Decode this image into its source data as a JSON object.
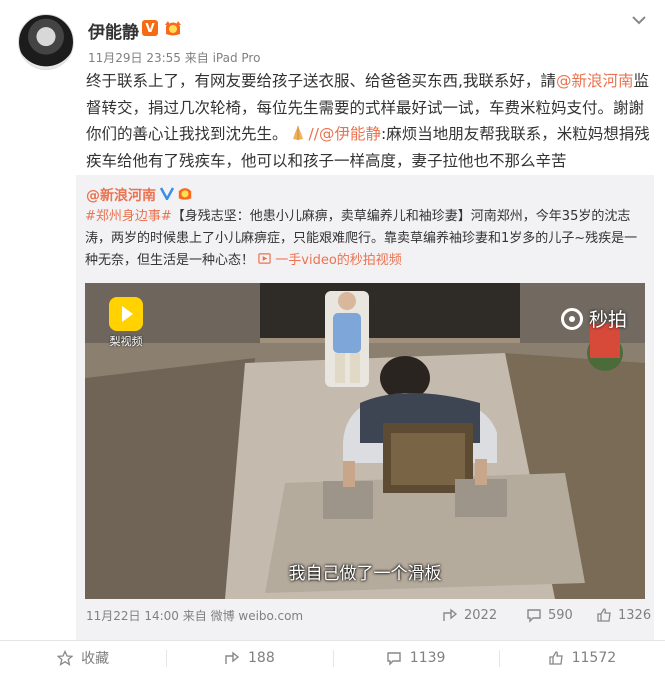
{
  "post": {
    "username": "伊能静",
    "verified_badge": "V",
    "timestamp": "11月29日 23:55",
    "source": "来自 iPad Pro",
    "text_parts": {
      "p1": "终于联系上了，有网友要给孩子送衣服、给爸爸买东西,我联系好，請",
      "mention1": "@新浪河南",
      "p2": "监督转交，捐过几次轮椅，每位先生需要的式样最好试一试，车费米粒妈支付。謝謝你们的善心让我找到沈先生。",
      "mention2": "//@伊能静",
      "p3": ":麻烦当地朋友帮我联系，米粒妈想捐残疾车给他有了残疾车，他可以和孩子一样高度，妻子拉他也不那么辛苦"
    }
  },
  "original": {
    "username": "@新浪河南",
    "text_parts": {
      "topic": "#郑州身边事#",
      "body": "【身残志坚：他患小儿麻痹，卖草编养儿和袖珍妻】河南郑州，今年35岁的沈志涛，两岁的时候患上了小儿麻痹症，只能艰难爬行。靠卖草编养袖珍妻和1岁多的儿子~残疾是一种无奈，但生活是一种心态！",
      "video_link": "一手video的秒拍视频"
    },
    "video": {
      "app_logo_label": "梨视频",
      "watermark": "秒拍",
      "subtitle": "我自己做了一个滑板"
    },
    "timestamp": "11月22日 14:00",
    "source": "来自 微博 weibo.com",
    "reposts": "2022",
    "comments": "590",
    "likes": "1326"
  },
  "actions": {
    "favorite": "收藏",
    "repost": "188",
    "comment": "1139",
    "like": "11572"
  },
  "colors": {
    "link": "#eb7350",
    "verified": "#f56a12",
    "weibo_blue": "#3a8ee6"
  }
}
